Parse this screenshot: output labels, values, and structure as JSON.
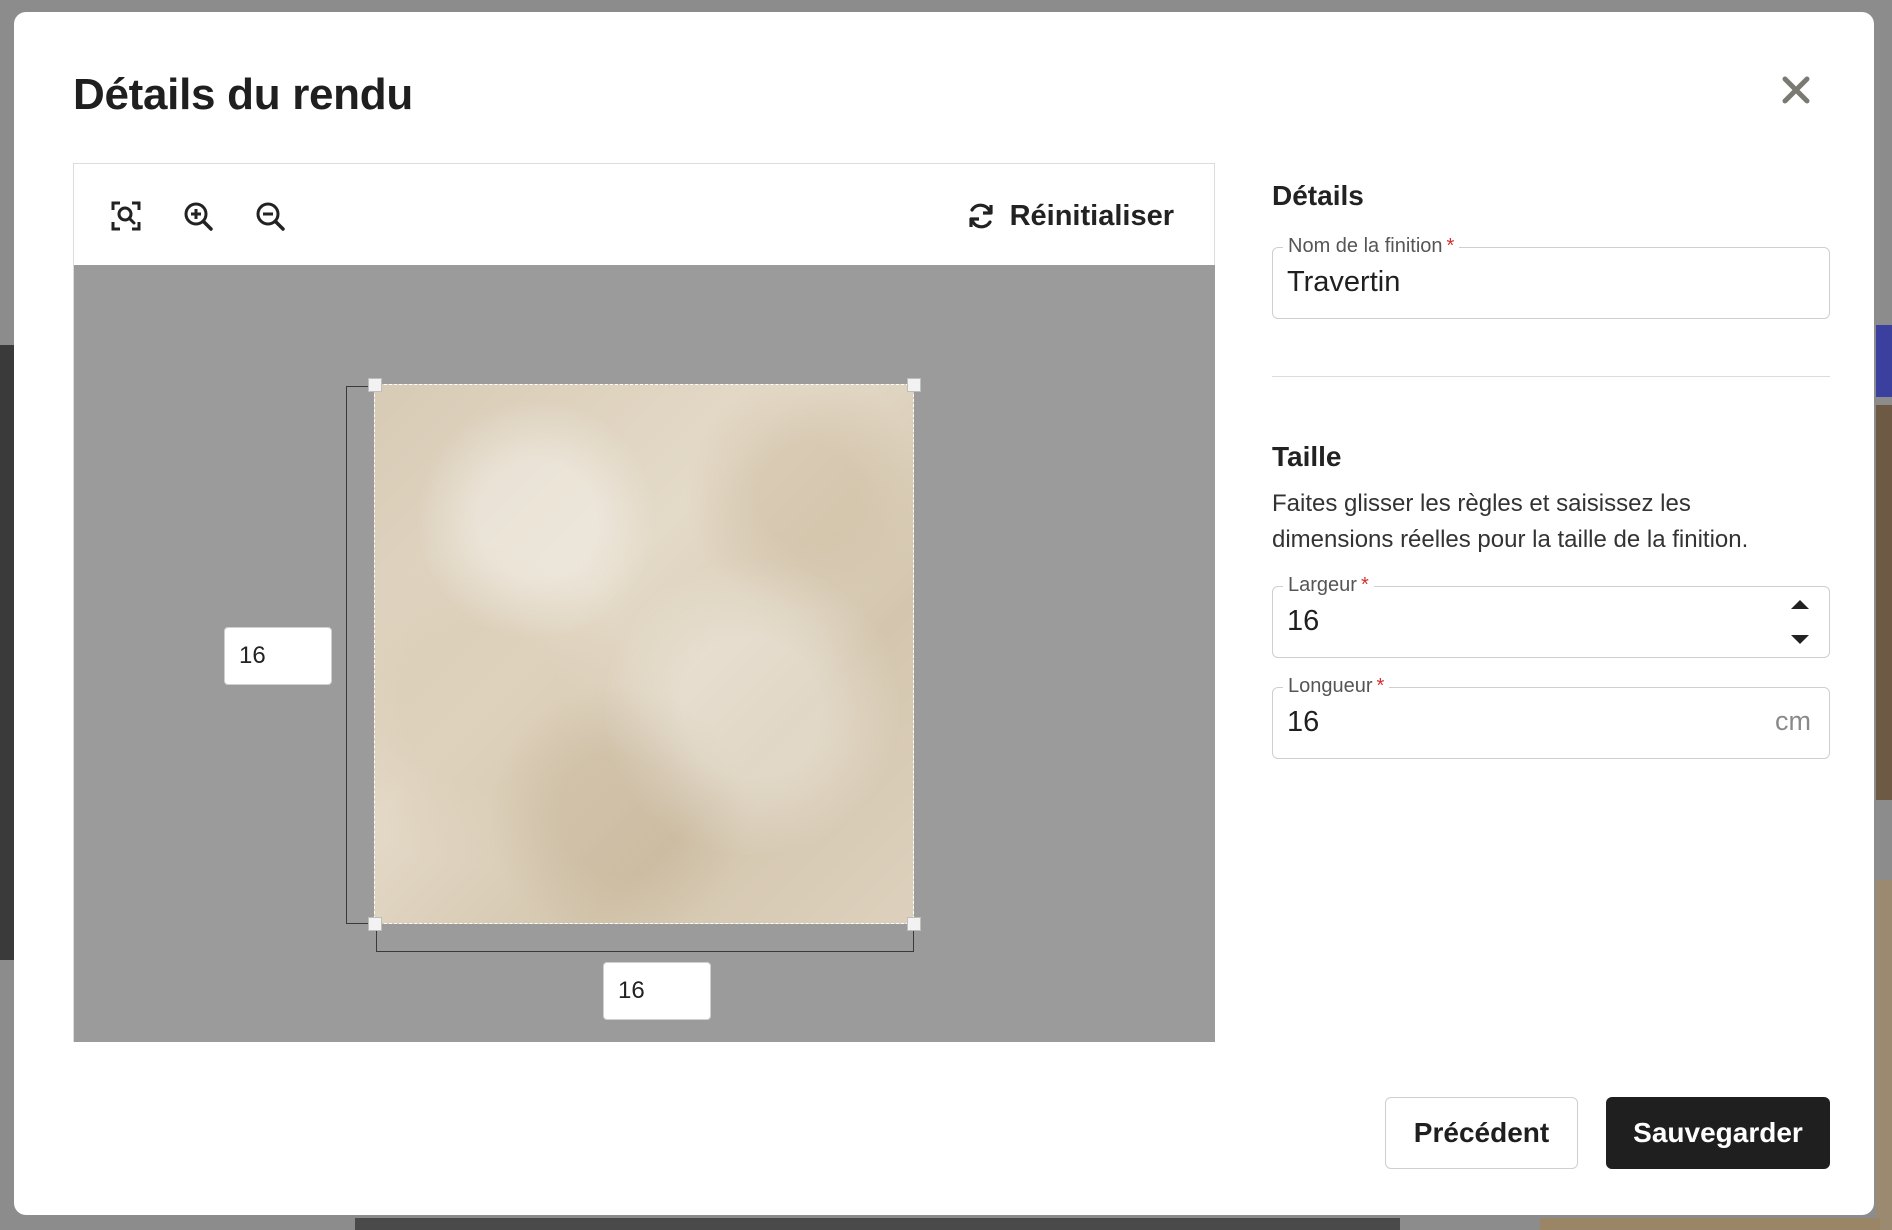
{
  "modal": {
    "title": "Détails du rendu"
  },
  "editor": {
    "toolbar": {
      "reset_label": "Réinitialiser"
    },
    "dimensions": {
      "vertical_value": "16",
      "horizontal_value": "16"
    }
  },
  "details": {
    "section_title": "Détails",
    "finish_name": {
      "label": "Nom de la finition",
      "required_mark": "*",
      "value": "Travertin"
    }
  },
  "size": {
    "section_title": "Taille",
    "help_text": "Faites glisser les règles et saisissez les dimensions réelles pour la taille de la finition.",
    "width": {
      "label": "Largeur",
      "required_mark": "*",
      "value": "16"
    },
    "length": {
      "label": "Longueur",
      "required_mark": "*",
      "value": "16",
      "unit": "cm"
    }
  },
  "footer": {
    "previous_label": "Précédent",
    "save_label": "Sauvegarder"
  },
  "icons": [
    "close-icon",
    "fit-to-view-icon",
    "zoom-in-icon",
    "zoom-out-icon",
    "refresh-icon",
    "chevron-up-icon",
    "chevron-down-icon"
  ],
  "colors": {
    "primary_button": "#1f1f1f",
    "canvas_background": "#9b9b9b",
    "required": "#d32f2f"
  }
}
